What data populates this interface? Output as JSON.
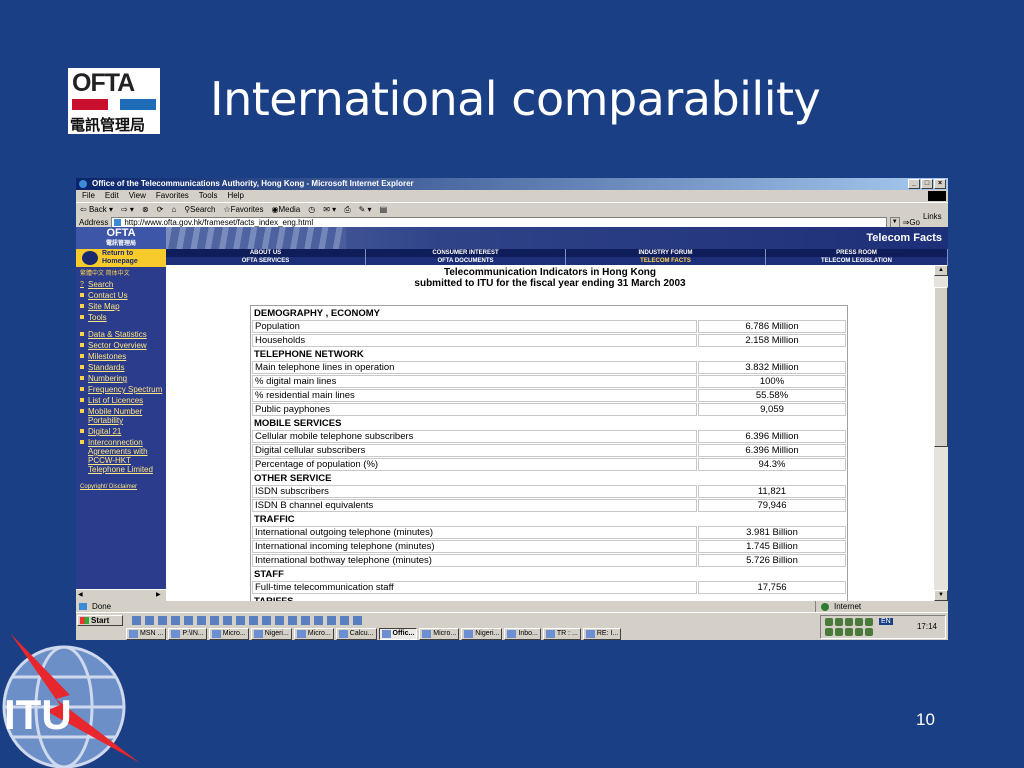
{
  "slide": {
    "title": "International comparability",
    "page_number": "10",
    "ofta_logo_word": "OFTA",
    "ofta_logo_chinese": "電訊管理局",
    "itu_logo_text": "ITU"
  },
  "window": {
    "title": "Office of the Telecommunications Authority, Hong Kong - Microsoft Internet Explorer",
    "buttons": [
      "_",
      "□",
      "×"
    ],
    "menu": [
      "File",
      "Edit",
      "View",
      "Favorites",
      "Tools",
      "Help"
    ],
    "toolbar": {
      "back": "Back",
      "search": "Search",
      "favorites": "Favorites",
      "media": "Media"
    },
    "address_label": "Address",
    "address_url": "http://www.ofta.gov.hk/frameset/facts_index_eng.html",
    "go": "Go",
    "links": "Links"
  },
  "site": {
    "logo": "OFTA",
    "logo_sub": "電訊管理局",
    "return_home": "Return to Homepage",
    "languages": "繁體中文  简体中文",
    "banner_title": "Telecom Facts",
    "nav_top": [
      "ABOUT US",
      "CONSUMER INTEREST",
      "INDUSTRY FORUM",
      "PRESS ROOM"
    ],
    "nav_bottom": [
      "OFTA SERVICES",
      "OFTA DOCUMENTS",
      "TELECOM FACTS",
      "TELECOM LEGISLATION"
    ],
    "side_links_top": [
      "Search",
      "Contact Us",
      "Site Map",
      "Tools"
    ],
    "side_links": [
      "Data & Statistics",
      "Sector Overview",
      "Milestones",
      "Standards",
      "Numbering",
      "Frequency Spectrum",
      "List of Licences",
      "Mobile Number Portability",
      "Digital 21",
      "Interconnection Agreements with PCCW-HKT Telephone Limited"
    ],
    "copyright": "Copyright",
    "disclaimer": "Disclaimer"
  },
  "content": {
    "heading_line1": "Telecommunication Indicators in Hong Kong",
    "heading_line2": "submitted to ITU for the fiscal year ending 31 March 2003"
  },
  "table": [
    {
      "section": "DEMOGRAPHY , ECONOMY"
    },
    {
      "label": "Population",
      "value": "6.786 Million"
    },
    {
      "label": "Households",
      "value": "2.158 Million"
    },
    {
      "section": "TELEPHONE NETWORK"
    },
    {
      "label": "Main telephone lines in operation",
      "value": "3.832 Million"
    },
    {
      "label": "% digital main lines",
      "value": "100%"
    },
    {
      "label": "% residential main lines",
      "value": "55.58%"
    },
    {
      "label": "Public payphones",
      "value": "9,059"
    },
    {
      "section": "MOBILE SERVICES"
    },
    {
      "label": "Cellular mobile telephone subscribers",
      "value": "6.396 Million"
    },
    {
      "label": "Digital cellular subscribers",
      "value": "6.396 Million"
    },
    {
      "label": "Percentage of population (%)",
      "value": "94.3%"
    },
    {
      "section": "OTHER SERVICE"
    },
    {
      "label": "ISDN subscribers",
      "value": "11,821"
    },
    {
      "label": "ISDN B channel equivalents",
      "value": "79,946"
    },
    {
      "section": "TRAFFIC"
    },
    {
      "label": "International outgoing telephone (minutes)",
      "value": "3.981 Billion"
    },
    {
      "label": "International incoming telephone (minutes)",
      "value": "1.745 Billion"
    },
    {
      "label": "International bothway telephone (minutes)",
      "value": "5.726 Billion"
    },
    {
      "section": "STAFF"
    },
    {
      "label": "Full-time telecommunication staff",
      "value": "17,756"
    },
    {
      "section": "TARIFFS"
    }
  ],
  "status": {
    "text": "Done",
    "zone": "Internet"
  },
  "taskbar": {
    "start": "Start",
    "tasks": [
      "MSN ...",
      "P:\\IN...",
      "Micro...",
      "Nigeri...",
      "Micro...",
      "Calcu...",
      "Offic...",
      "Micro...",
      "Nigeri...",
      "Inbo...",
      "TR : ...",
      "RE: I..."
    ],
    "active_task_index": 6,
    "lang": "EN",
    "clock": "17:14"
  }
}
